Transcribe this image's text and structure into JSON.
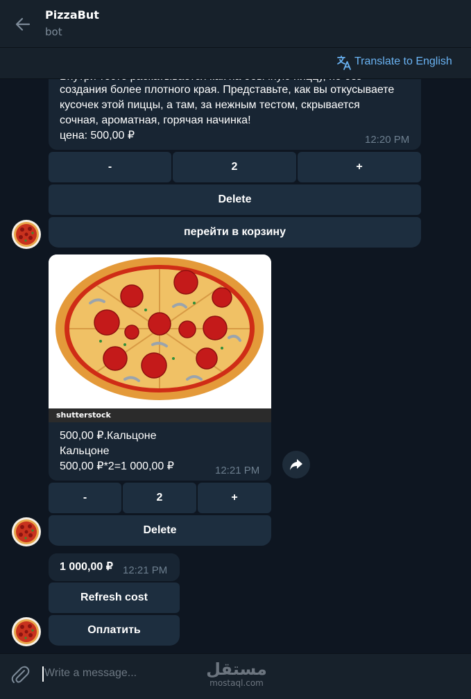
{
  "header": {
    "title": "PizzaBut",
    "subtitle": "bot"
  },
  "translate": {
    "label": "Translate to English",
    "color": "#6ab3f3"
  },
  "messages": {
    "first": {
      "lines": [
        "Внутри тесто раскатывается как на обычную пиццу, но без",
        "создания более плотного края. Представьте, как вы откусываете",
        "кусочек этой пиццы, а там, за нежным тестом, скрывается",
        "сочная, ароматная, горячая начинка!",
        "цена: 500,00 ₽"
      ],
      "time": "12:20 PM",
      "keyboard": {
        "minus": "-",
        "qty": "2",
        "plus": "+",
        "delete": "Delete",
        "cart": "перейти в корзину"
      }
    },
    "second": {
      "photo_watermark": "shutterstock",
      "lines": [
        "500,00 ₽.Кальцоне",
        "Кальцоне",
        "500,00 ₽*2=1 000,00 ₽"
      ],
      "time": "12:21 PM",
      "keyboard": {
        "minus": "-",
        "qty": "2",
        "plus": "+",
        "delete": "Delete"
      }
    },
    "third": {
      "text": "1 000,00 ₽",
      "time": "12:21 PM",
      "keyboard": {
        "refresh": "Refresh cost",
        "pay": "Оплатить"
      }
    }
  },
  "composer": {
    "placeholder": "Write a message..."
  },
  "watermark": {
    "arabic": "مستقل",
    "latin": "mostaql.com"
  },
  "colors": {
    "background": "#0e1621",
    "panel": "#17212b",
    "bubble": "#182533",
    "button": "#1d2e3f",
    "link": "#6ab3f3"
  }
}
